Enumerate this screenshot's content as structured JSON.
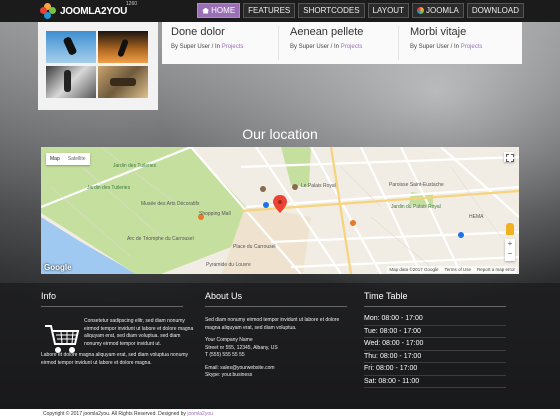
{
  "brand": {
    "name": "JOOMLA2YOU",
    "sup": "1260"
  },
  "nav": {
    "items": [
      {
        "label": "HOME",
        "icon": "home-icon",
        "active": true
      },
      {
        "label": "FEATURES",
        "active": false
      },
      {
        "label": "SHORTCODES",
        "active": false
      },
      {
        "label": "LAYOUT",
        "active": false
      },
      {
        "label": "JOOMLA",
        "icon": "joomla-icon",
        "active": false
      },
      {
        "label": "DOWNLOAD",
        "active": false
      }
    ]
  },
  "posts": [
    {
      "title": "Done dolor",
      "by": "By Super User / In ",
      "category": "Projects"
    },
    {
      "title": "Aenean pellete",
      "by": "By Super User / In ",
      "category": "Projects"
    },
    {
      "title": "Morbi vitaje",
      "by": "By Super User / In ",
      "category": "Projects"
    }
  ],
  "location": {
    "title": "Our location",
    "map_tab_map": "Map",
    "map_tab_satellite": "Satellite",
    "labels": {
      "tuileries": "Jardin des Tuileries",
      "musee": "Musée des Arts Décoratifs",
      "shopping": "Shopping Mall",
      "arc": "Arc de Triomphe du Carrousel",
      "place": "Place du Carrousel",
      "pyramide": "Pyramide du Louvre",
      "palais": "Le Palais Royal",
      "saint_eustache": "Paroisse Saint-Eustache",
      "hema": "HEMA",
      "jardin_palais": "Jardin du Palais Royal",
      "jardin_left": "Jardin des Tuileries"
    },
    "google": "Google",
    "footer": [
      "Map data ©2017 Google",
      "Terms of Use",
      "Report a map error"
    ]
  },
  "info": {
    "title": "Info",
    "para1": "Consetetur sadipscing elitr, sed diam nonumy eirmod tempor invidunt ut labore et dolore magna aliquyam erat, sed diam voluptua. sed diam nonumy eirmod tempor invidunt ut.",
    "para2": "Labore et dolore magna aliquyam erat, sed diam voluptua nonumy eirmod tempor invidunt ut labore et dolore magna."
  },
  "about": {
    "title": "About Us",
    "para": "Sed diam nonumy eirmod tempor invidunt ut labore et dolore magna aliquyam erat, sed diam voluptua.",
    "company": "Your Company Name",
    "street": "Street nr 555, 12345, Albany, US",
    "phone": "T (555) 555 55 55",
    "email": "Email: sales@yourwebsite.com",
    "skype": "Skype: your.business"
  },
  "timetable": {
    "title": "Time Table",
    "rows": [
      "Mon: 08:00 - 17:00",
      "Tue: 08:00 - 17:00",
      "Wed: 08:00 - 17:00",
      "Thu: 08:00 - 17:00",
      "Fri: 08:00 - 17:00",
      "Sat: 08:00 - 11:00"
    ]
  },
  "copyright": {
    "text": "Copyright © 2017 joomla2you. All Rights Reserved. Designed by ",
    "link": "joomla2you"
  }
}
